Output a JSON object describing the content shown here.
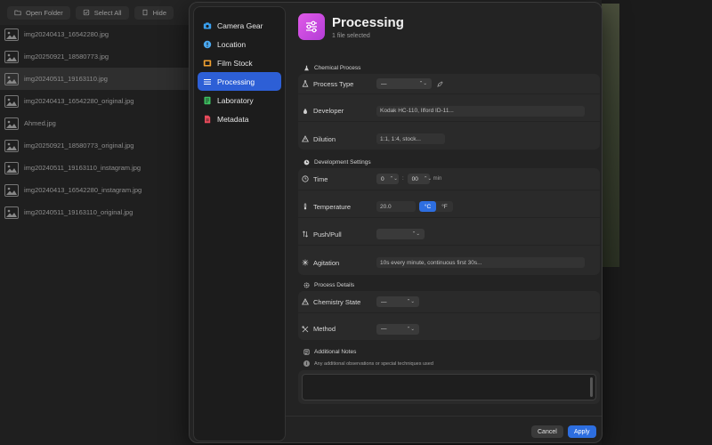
{
  "toolbar": {
    "open_folder": "Open Folder",
    "select_all": "Select All",
    "hide": "Hide"
  },
  "files": [
    {
      "name": "img20240413_16542280.jpg",
      "selected": false
    },
    {
      "name": "img20250921_18580773.jpg",
      "selected": false
    },
    {
      "name": "img20240511_19163110.jpg",
      "selected": true
    },
    {
      "name": "img20240413_16542280_original.jpg",
      "selected": false
    },
    {
      "name": "Ahmed.jpg",
      "selected": false
    },
    {
      "name": "img20250921_18580773_original.jpg",
      "selected": false
    },
    {
      "name": "img20240511_19163110_instagram.jpg",
      "selected": false
    },
    {
      "name": "img20240413_16542280_instagram.jpg",
      "selected": false
    },
    {
      "name": "img20240511_19163110_original.jpg",
      "selected": false
    }
  ],
  "sidebar": {
    "items": [
      {
        "label": "Camera Gear",
        "icon": "camera-icon",
        "color": "#3aa0f0"
      },
      {
        "label": "Location",
        "icon": "location-icon",
        "color": "#4aa8f0"
      },
      {
        "label": "Film Stock",
        "icon": "film-icon",
        "color": "#f0a030"
      },
      {
        "label": "Processing",
        "icon": "sliders-icon",
        "color": "#ffffff"
      },
      {
        "label": "Laboratory",
        "icon": "laboratory-icon",
        "color": "#3cc060"
      },
      {
        "label": "Metadata",
        "icon": "metadata-icon",
        "color": "#e84a5a"
      }
    ],
    "active": "Processing"
  },
  "header": {
    "title": "Processing",
    "subtitle": "1 file selected"
  },
  "sections": {
    "chemical": {
      "title": "Chemical Process",
      "process_type_label": "Process Type",
      "process_type_value": "—",
      "developer_label": "Developer",
      "developer_placeholder": "Kodak HC-110, Ilford ID-11...",
      "dilution_label": "Dilution",
      "dilution_placeholder": "1:1, 1:4, stock..."
    },
    "development": {
      "title": "Development Settings",
      "time_label": "Time",
      "time_minutes": "0",
      "time_seconds": "00",
      "time_separator": ":",
      "time_unit": "min",
      "temperature_label": "Temperature",
      "temperature_value": "20.0",
      "unit_c": "°C",
      "unit_f": "°F",
      "pushpull_label": "Push/Pull",
      "pushpull_value": "",
      "agitation_label": "Agitation",
      "agitation_placeholder": "10s every minute, continuous first 30s..."
    },
    "details": {
      "title": "Process Details",
      "chemistry_label": "Chemistry State",
      "chemistry_value": "—",
      "method_label": "Method",
      "method_value": "—"
    },
    "notes": {
      "title": "Additional Notes",
      "hint": "Any additional observations or special techniques used",
      "value": ""
    }
  },
  "footer": {
    "cancel": "Cancel",
    "apply": "Apply"
  }
}
